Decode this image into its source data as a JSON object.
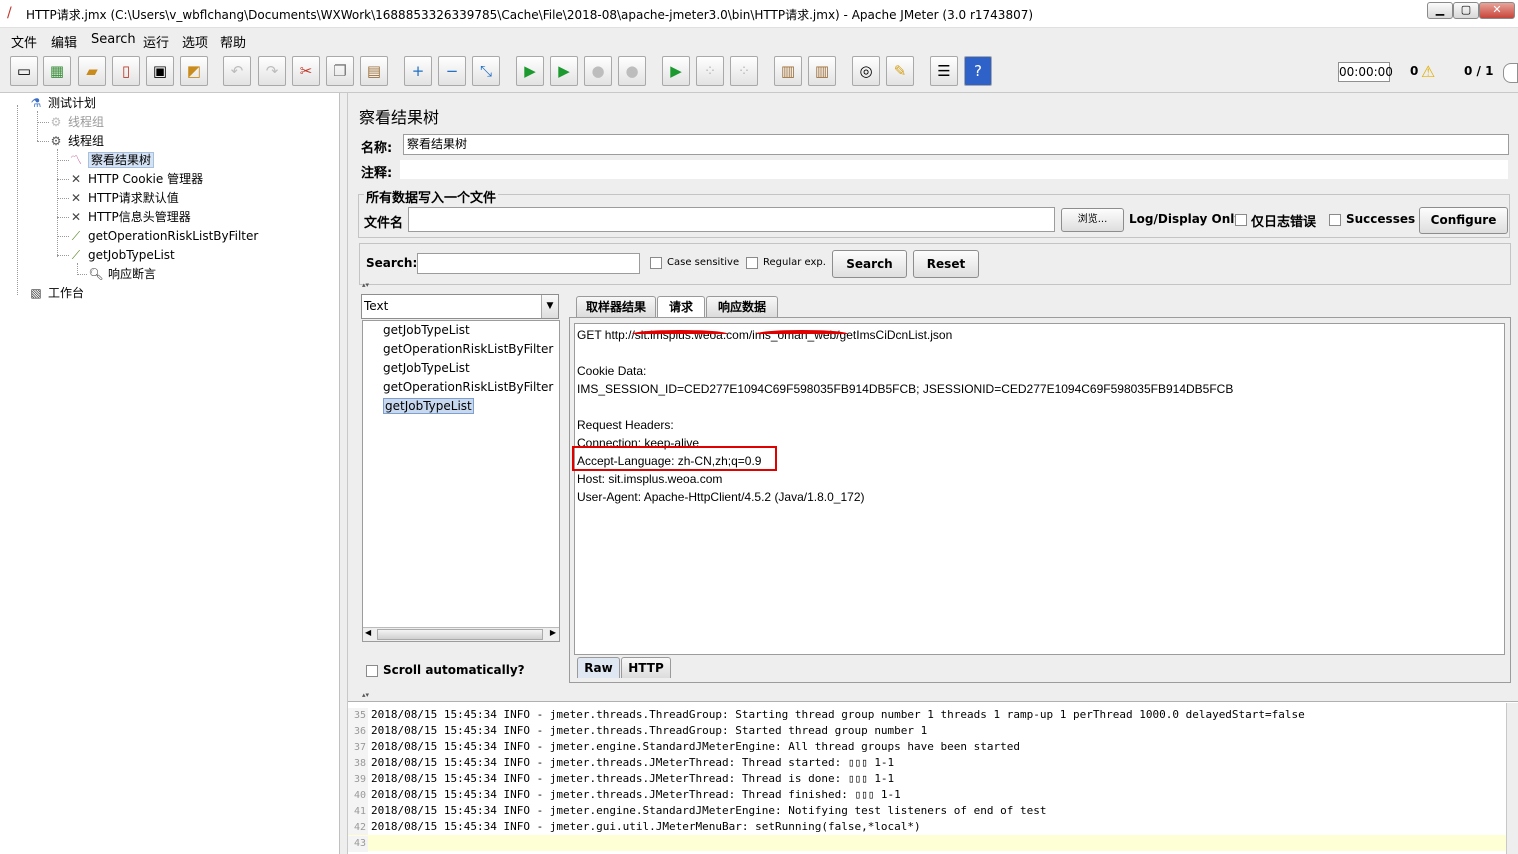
{
  "window": {
    "title": "HTTP请求.jmx (C:\\Users\\v_wbflchang\\Documents\\WXWork\\1688853326339785\\Cache\\File\\2018-08\\apache-jmeter3.0\\bin\\HTTP请求.jmx) - Apache JMeter (3.0 r1743807)",
    "min": "▁",
    "max": "▢",
    "close": "✕"
  },
  "menu": [
    "文件",
    "编辑",
    "Search",
    "运行",
    "选项",
    "帮助"
  ],
  "status": {
    "timer": "00:00:00",
    "errors": "0",
    "threads": "0 / 1"
  },
  "tree": {
    "root": "测试计划",
    "group_disabled": "线程组",
    "group": "线程组",
    "children": [
      "察看结果树",
      "HTTP Cookie 管理器",
      "HTTP请求默认值",
      "HTTP信息头管理器",
      "getOperationRiskListByFilter",
      "getJobTypeList"
    ],
    "assertion": "响应断言",
    "workbench": "工作台"
  },
  "panel": {
    "title": "察看结果树",
    "name_label": "名称:",
    "name_value": "察看结果树",
    "comment_label": "注释:",
    "file_group": "所有数据写入一个文件",
    "file_label": "文件名",
    "browse": "浏览...",
    "log_display": "Log/Display Only:",
    "errors_only": "仅日志错误",
    "successes": "Successes",
    "configure": "Configure"
  },
  "search": {
    "label": "Search:",
    "case_sensitive": "Case sensitive",
    "regexp": "Regular exp.",
    "search_btn": "Search",
    "reset_btn": "Reset"
  },
  "renderer": "Text",
  "results": [
    "getJobTypeList",
    "getOperationRiskListByFilter",
    "getJobTypeList",
    "getOperationRiskListByFilter",
    "getJobTypeList"
  ],
  "scroll_auto": "Scroll automatically?",
  "tabs": [
    "取样器结果",
    "请求",
    "响应数据"
  ],
  "request": {
    "line": "GET http://sit.imsplus.weoa.com/ims_oman_web/getImsCiDcnList.json",
    "cookie_header": "Cookie Data:",
    "cookie": "IMS_SESSION_ID=CED277E1094C69F598035FB914DB5FCB; JSESSIONID=CED277E1094C69F598035FB914DB5FCB",
    "headers_title": "Request Headers:",
    "connection": "Connection: keep-alive",
    "accept_language": "Accept-Language: zh-CN,zh;q=0.9",
    "host": "Host: sit.imsplus.weoa.com",
    "user_agent": "User-Agent: Apache-HttpClient/4.5.2 (Java/1.8.0_172)"
  },
  "bottom_tabs": [
    "Raw",
    "HTTP"
  ],
  "log": [
    {
      "n": "35",
      "t": "2018/08/15 15:45:34 INFO  - jmeter.threads.ThreadGroup: Starting thread group number 1 threads 1 ramp-up 1 perThread 1000.0 delayedStart=false"
    },
    {
      "n": "36",
      "t": "2018/08/15 15:45:34 INFO  - jmeter.threads.ThreadGroup: Started thread group number 1"
    },
    {
      "n": "37",
      "t": "2018/08/15 15:45:34 INFO  - jmeter.engine.StandardJMeterEngine: All thread groups have been started"
    },
    {
      "n": "38",
      "t": "2018/08/15 15:45:34 INFO  - jmeter.threads.JMeterThread: Thread started: ▯▯▯ 1-1"
    },
    {
      "n": "39",
      "t": "2018/08/15 15:45:34 INFO  - jmeter.threads.JMeterThread: Thread is done: ▯▯▯ 1-1"
    },
    {
      "n": "40",
      "t": "2018/08/15 15:45:34 INFO  - jmeter.threads.JMeterThread: Thread finished: ▯▯▯ 1-1"
    },
    {
      "n": "41",
      "t": "2018/08/15 15:45:34 INFO  - jmeter.engine.StandardJMeterEngine: Notifying test listeners of end of test"
    },
    {
      "n": "42",
      "t": "2018/08/15 15:45:34 INFO  - jmeter.gui.util.JMeterMenuBar: setRunning(false,*local*)"
    },
    {
      "n": "43",
      "t": ""
    }
  ]
}
